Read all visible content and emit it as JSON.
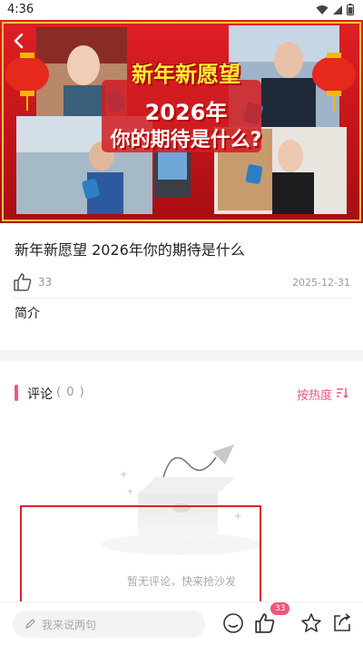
{
  "status_bar": {
    "time": "4:36"
  },
  "hero": {
    "line1": "新年新愿望",
    "line2": "2026年",
    "line3": "你的期待是什么?"
  },
  "video": {
    "title": "新年新愿望 2026年你的期待是什么",
    "like_count": "33",
    "publish_date": "2025-12-31",
    "intro_label": "简介"
  },
  "comments": {
    "title": "评论",
    "count": "( 0 )",
    "sort_label": "按热度",
    "empty_text": "暂无评论，快来抢沙发"
  },
  "bottom_bar": {
    "input_placeholder": "我来说两句",
    "like_badge": "33"
  },
  "colors": {
    "accent": "#f2557e",
    "hero_red": "#c8121a"
  }
}
